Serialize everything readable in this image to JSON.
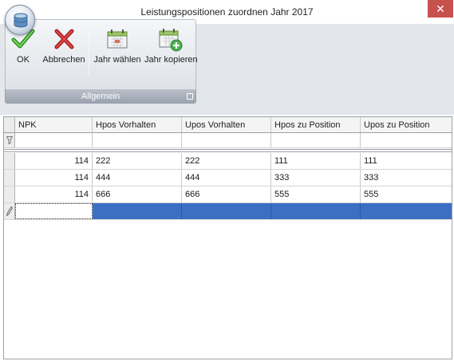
{
  "window": {
    "title": "Leistungspositionen zuordnen Jahr 2017",
    "close_glyph": "✕",
    "app_icon": "database-icon"
  },
  "ribbon": {
    "group_caption": "Allgemein",
    "buttons": [
      {
        "label": "OK",
        "icon": "checkmark-icon"
      },
      {
        "label": "Abbrechen",
        "icon": "red-x-icon"
      },
      {
        "label": "Jahr wählen",
        "icon": "calendar-icon"
      },
      {
        "label": "Jahr kopieren",
        "icon": "calendar-add-icon"
      }
    ]
  },
  "grid": {
    "columns": [
      "NPK",
      "Hpos Vorhalten",
      "Upos Vorhalten",
      "Hpos zu Position",
      "Upos zu Position"
    ],
    "rows": [
      [
        "114",
        "222",
        "222",
        "111",
        "111"
      ],
      [
        "114",
        "444",
        "444",
        "333",
        "333"
      ],
      [
        "114",
        "666",
        "666",
        "555",
        "555"
      ]
    ],
    "new_row": [
      "",
      "",
      "",
      "",
      ""
    ]
  },
  "colors": {
    "selection": "#3a6fc4",
    "close_button": "#c7514d",
    "ribbon_caption": "#9ba3af"
  }
}
